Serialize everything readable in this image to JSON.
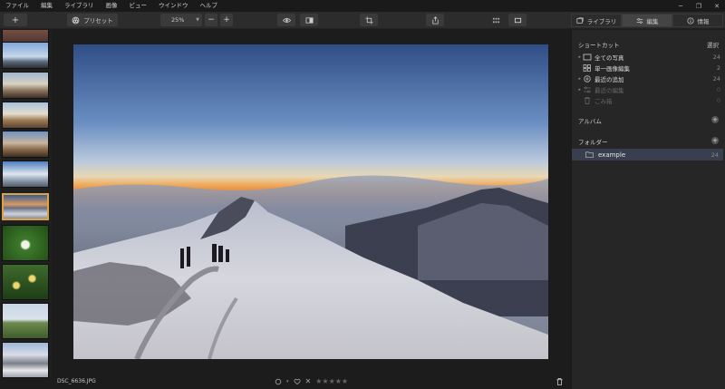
{
  "menubar": {
    "items": [
      "ファイル",
      "編集",
      "ライブラリ",
      "画像",
      "ビュー",
      "ウインドウ",
      "ヘルプ"
    ],
    "controls": [
      "─",
      "❐",
      "✕"
    ]
  },
  "toolbar": {
    "add_label": "+",
    "presets_label": "プリセット",
    "zoom_value": "25%",
    "zoom_out": "−",
    "zoom_in": "+"
  },
  "right_tabs": [
    {
      "label": "ライブラリ",
      "icon": "library-icon",
      "active": false
    },
    {
      "label": "編集",
      "icon": "sliders-icon",
      "active": true
    },
    {
      "label": "情報",
      "icon": "info-icon",
      "active": false
    }
  ],
  "shortcuts": {
    "title": "ショートカット",
    "select_label": "選択",
    "items": [
      {
        "label": "全ての写真",
        "count": "24",
        "icon": "photos-icon",
        "dim": false
      },
      {
        "label": "単一画像編集",
        "count": "2",
        "icon": "grid-icon",
        "dim": false
      },
      {
        "label": "最近の追加",
        "count": "24",
        "icon": "plus-circle-icon",
        "dim": false
      },
      {
        "label": "最近の編集",
        "count": "0",
        "icon": "sliders-icon",
        "dim": true
      },
      {
        "label": "ごみ箱",
        "count": "0",
        "icon": "trash-icon",
        "dim": true
      }
    ]
  },
  "albums": {
    "title": "アルバム"
  },
  "folders": {
    "title": "フォルダー",
    "items": [
      {
        "label": "example",
        "count": "24"
      }
    ]
  },
  "status": {
    "filename": "DSC_6636.JPG",
    "reject": "✕",
    "stars": "★★★★★"
  },
  "colors": {
    "accent_selected": "#d9a441",
    "folder_highlight": "#3a3f4f"
  }
}
